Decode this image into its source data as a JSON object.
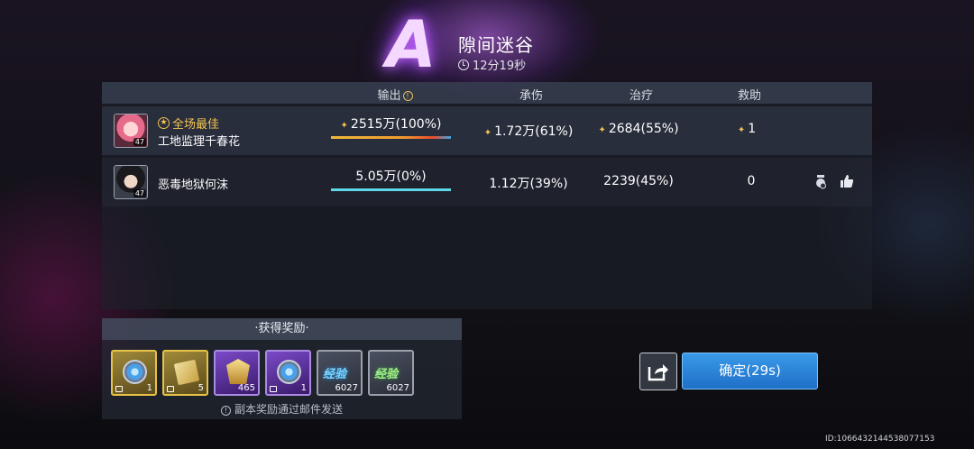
{
  "result": {
    "grade": "A",
    "stage_name": "隙间迷谷",
    "time": "12分19秒"
  },
  "table": {
    "headers": [
      "输出",
      "承伤",
      "治疗",
      "救助"
    ],
    "players": [
      {
        "badge": "全场最佳",
        "name": "工地监理千春花",
        "level": "47",
        "output": "2515万(100%)",
        "damage_taken": "1.72万(61%)",
        "healing": "2684(55%)",
        "rescue": "1",
        "output_share": 1.0
      },
      {
        "name": "恶毒地狱何沫",
        "level": "47",
        "output": "5.05万(0%)",
        "damage_taken": "1.12万(39%)",
        "healing": "2239(45%)",
        "rescue": "0",
        "output_share": 1.0
      }
    ]
  },
  "rewards": {
    "title": "·获得奖励·",
    "items": [
      {
        "icon": "crystal-gem-icon",
        "qty": "1",
        "rarity": "gold"
      },
      {
        "icon": "tickets-icon",
        "qty": "5",
        "rarity": "gold"
      },
      {
        "icon": "crest-icon",
        "qty": "465",
        "rarity": "purple"
      },
      {
        "icon": "crystal-gem-icon",
        "qty": "1",
        "rarity": "purple"
      },
      {
        "icon": "exp-blue-icon",
        "label": "经验",
        "qty": "6027",
        "rarity": "gray"
      },
      {
        "icon": "exp-green-icon",
        "label": "经验",
        "qty": "6027",
        "rarity": "gray"
      }
    ],
    "note": "副本奖励通过邮件发送"
  },
  "buttons": {
    "confirm": "确定(29s)"
  },
  "uid": "ID:1066432144538077153"
}
